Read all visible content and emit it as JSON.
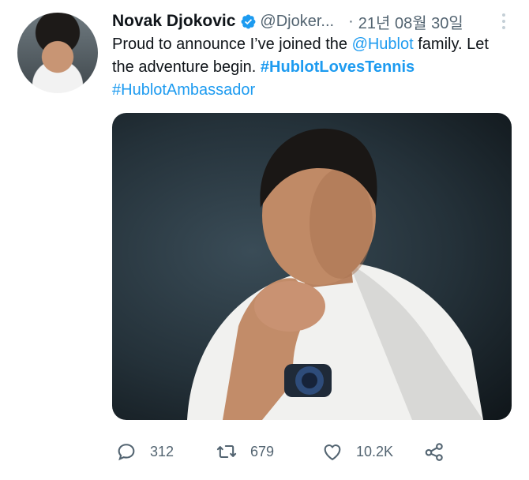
{
  "tweet": {
    "author_name": "Novak Djokovic",
    "handle": "@Djoker...",
    "separator": "·",
    "timestamp": "21년 08월 30일",
    "text_part1": "Proud to announce I’ve joined the ",
    "mention": "@Hublot",
    "text_part2": " family. Let the adventure begin. ",
    "hashtag1": "#HublotLovesTennis",
    "hashtag2": "#HublotAmbassador"
  },
  "actions": {
    "replies": "312",
    "retweets": "679",
    "likes": "10.2K"
  },
  "icons": {
    "reply": "speech-bubble-icon",
    "retweet": "retweet-icon",
    "like": "heart-icon",
    "share": "share-icon",
    "more": "more-vertical-icon",
    "verified": "verified-badge-icon"
  },
  "colors": {
    "accent": "#1d9bf0",
    "secondary_text": "#536471",
    "primary_text": "#0f1419"
  }
}
